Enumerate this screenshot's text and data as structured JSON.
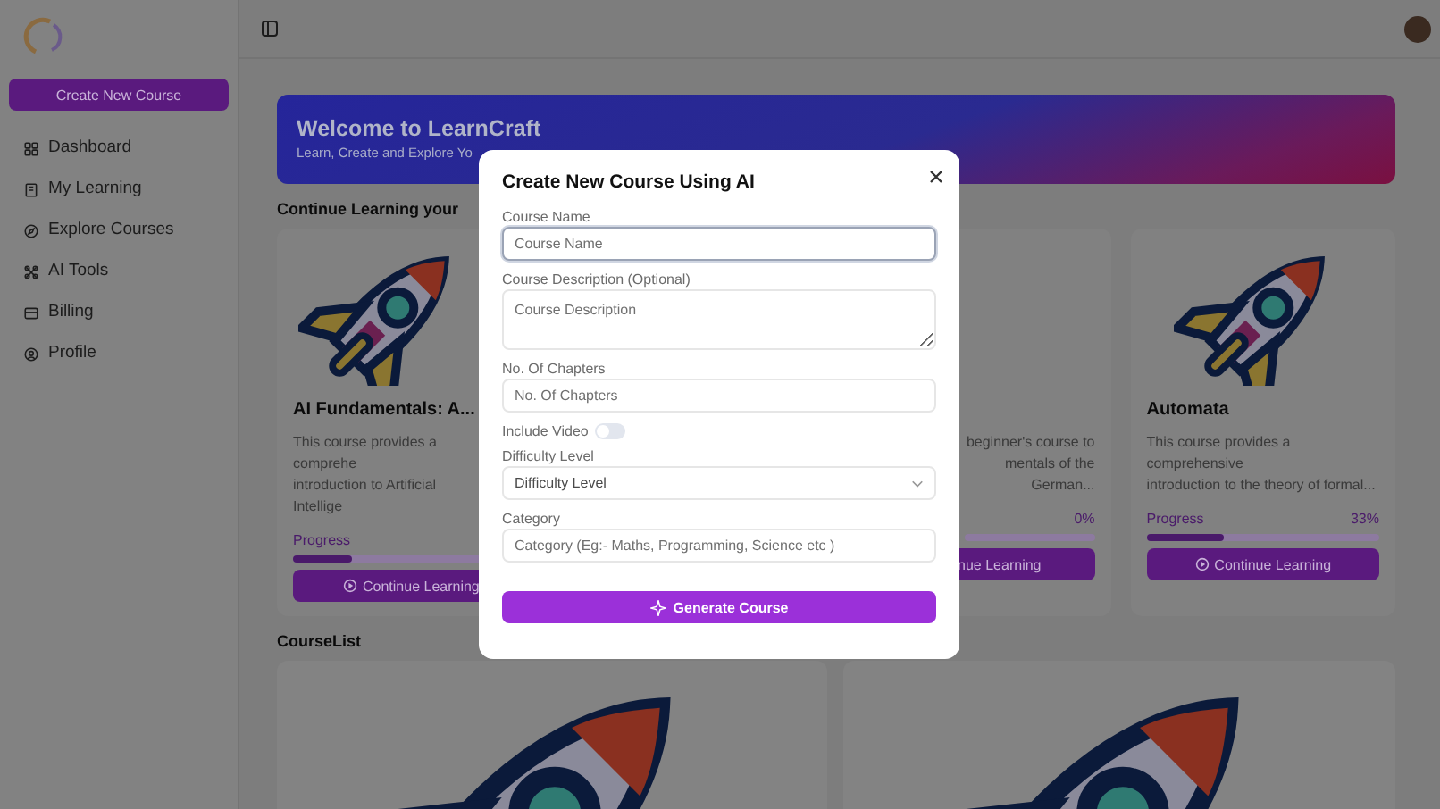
{
  "sidebar": {
    "create_button": "Create New Course",
    "items": [
      {
        "label": "Dashboard"
      },
      {
        "label": "My Learning"
      },
      {
        "label": "Explore Courses"
      },
      {
        "label": "AI Tools"
      },
      {
        "label": "Billing"
      },
      {
        "label": "Profile"
      }
    ]
  },
  "banner": {
    "title": "Welcome to LearnCraft",
    "subtitle": "Learn, Create and Explore Yo"
  },
  "continue_learning": {
    "heading": "Continue Learning your",
    "courses": [
      {
        "kind": "cut_right",
        "title": "AI Fundamentals: A...",
        "description": [
          "This course provides a comprehe",
          "introduction to Artificial Intellige"
        ],
        "progress_label": "Progress",
        "level": 0.25,
        "button": "Continue Learning"
      },
      {
        "kind": "cut_left",
        "description": [
          "beginner's course to",
          "mentals of the German..."
        ],
        "percent": "0%",
        "level": 0,
        "button": "nue Learning"
      },
      {
        "kind": "full",
        "title": "Automata",
        "description": [
          "This course provides a comprehensive",
          "introduction to the theory of formal..."
        ],
        "progress_label": "Progress",
        "percent": "33%",
        "level": 0.33,
        "button": "Continue Learning"
      }
    ]
  },
  "course_list": {
    "heading": "CourseList"
  },
  "modal": {
    "title": "Create New Course Using AI",
    "fields": [
      {
        "kind": "text",
        "label": "Course Name",
        "placeholder": "Course Name",
        "focused": true
      },
      {
        "kind": "textarea",
        "label": "Course Description (Optional)",
        "placeholder": "Course Description",
        "focused": false
      },
      {
        "kind": "text",
        "label": "No. Of Chapters",
        "placeholder": "No. Of Chapters",
        "focused": false
      },
      {
        "kind": "switch",
        "label": "Include Video",
        "on": false
      },
      {
        "kind": "select",
        "label": "Difficulty Level",
        "placeholder": "Difficulty Level",
        "focused": false
      },
      {
        "kind": "text",
        "label": "Category",
        "placeholder": "Category (Eg:- Maths, Programming, Science etc )",
        "focused": false
      }
    ],
    "submit": "Generate Course"
  }
}
